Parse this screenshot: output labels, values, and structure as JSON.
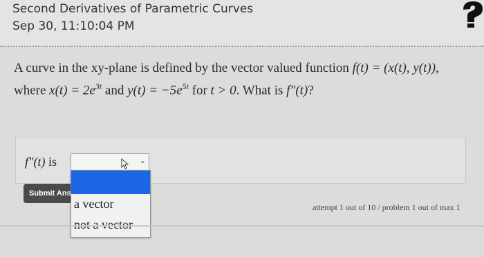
{
  "header": {
    "title": "Second Derivatives of Parametric Curves",
    "date": "Sep 30, 11:10:04 PM",
    "help_icon": "question-mark-icon"
  },
  "question": {
    "line1_prefix": "A curve in the xy-plane is defined by the vector valued function ",
    "line1_math": "f(t) = (x(t), y(t)),",
    "line2_prefix": "where ",
    "x_def": "x(t) = 2e",
    "x_exp": "3t",
    "and_text": " and ",
    "y_def": "y(t) = −5e",
    "y_exp": "5t",
    "cond_text": " for ",
    "cond_math": "t > 0",
    "ask_text": ". What is ",
    "ask_math": "f″(t)",
    "ask_end": "?"
  },
  "answer": {
    "label_math": "f″(t)",
    "label_text": " is",
    "select_value": "",
    "select_caret": "⌄",
    "options": [
      "a vector",
      "not a vector"
    ]
  },
  "submit_label": "Submit Answers",
  "attempt_text": "attempt 1 out of 10 / problem 1 out of max 1",
  "colors": {
    "highlight": "#1a66e3",
    "submit_bg": "#4a4a4a",
    "page_bg": "#dcdcda"
  }
}
